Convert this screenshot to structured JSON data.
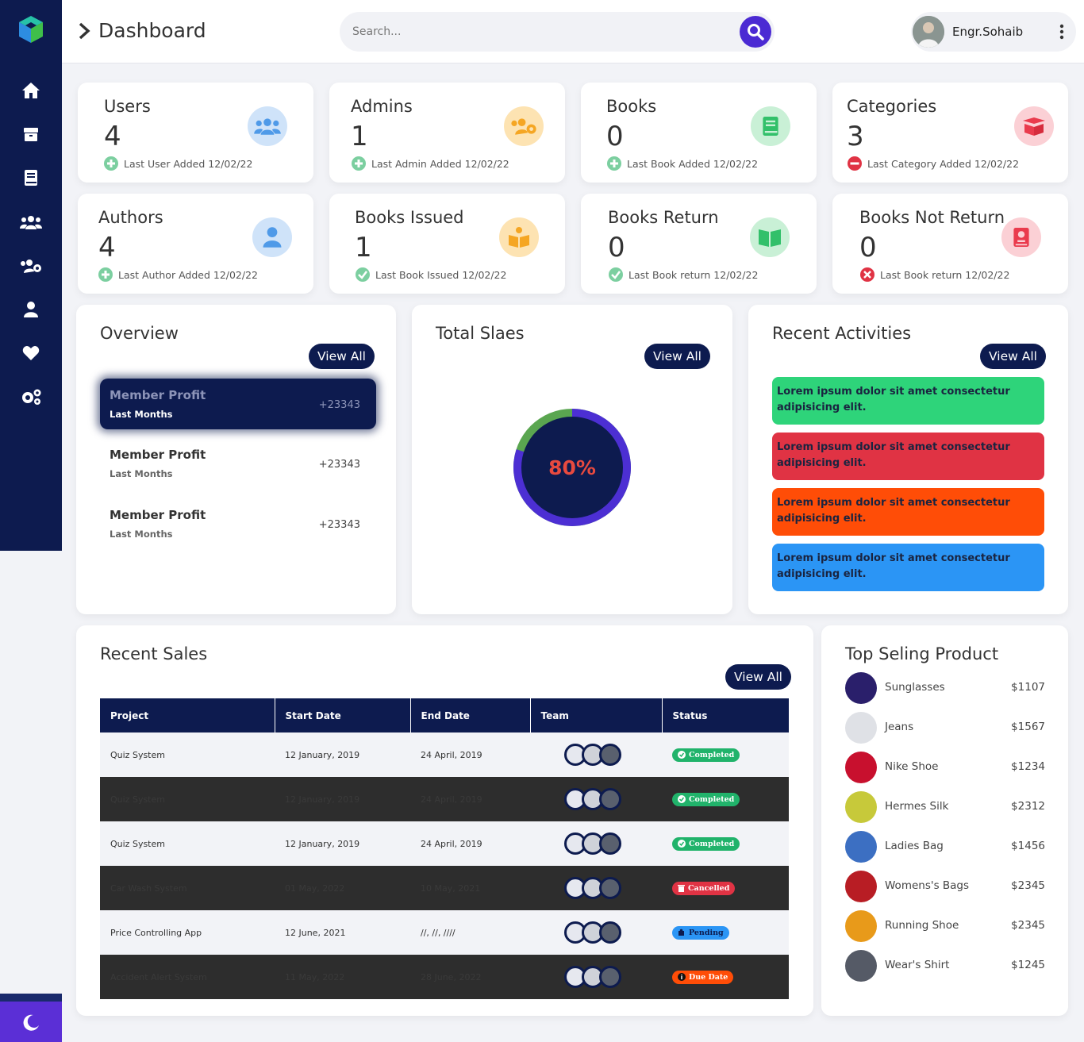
{
  "header": {
    "title": "Dashboard",
    "search_placeholder": "Search...",
    "user_name": "Engr.Sohaib"
  },
  "sidebar": {
    "items": [
      "home-icon",
      "box-icon",
      "book-icon",
      "users-icon",
      "users-cog-icon",
      "user-icon",
      "heart-icon",
      "cogs-icon"
    ],
    "theme_toggle": "moon-icon"
  },
  "stats": [
    {
      "label": "Users",
      "value": "4",
      "footer": "Last User Added 12/02/22",
      "icon": "users-icon",
      "footer_icon": "plus-circle-icon"
    },
    {
      "label": "Admins",
      "value": "1",
      "footer": "Last Admin Added 12/02/22",
      "icon": "users-cog-icon",
      "footer_icon": "plus-circle-icon"
    },
    {
      "label": "Books",
      "value": "0",
      "footer": "Last Book Added 12/02/22",
      "icon": "book-icon",
      "footer_icon": "plus-circle-icon"
    },
    {
      "label": "Categories",
      "value": "3",
      "footer": "Last Category Added 12/02/22",
      "icon": "box-open-icon",
      "footer_icon": "minus-circle-icon"
    },
    {
      "label": "Authors",
      "value": "4",
      "footer": "Last Author Added 12/02/22",
      "icon": "user-icon",
      "footer_icon": "plus-circle-icon"
    },
    {
      "label": "Books Issued",
      "value": "1",
      "footer": "Last Book Issued 12/02/22",
      "icon": "book-reader-icon",
      "footer_icon": "check-circle-icon"
    },
    {
      "label": "Books Return",
      "value": "0",
      "footer": "Last Book return 12/02/22",
      "icon": "book-open-icon",
      "footer_icon": "check-circle-icon"
    },
    {
      "label": "Books Not Return",
      "value": "0",
      "footer": "Last Book return 12/02/22",
      "icon": "book-dead-icon",
      "footer_icon": "times-circle-icon"
    }
  ],
  "overview": {
    "title": "Overview",
    "view_all": "View All",
    "items": [
      {
        "title": "Member Profit",
        "subtitle": "Last Months",
        "value": "+23343"
      },
      {
        "title": "Member Profit",
        "subtitle": "Last Months",
        "value": "+23343"
      },
      {
        "title": "Member Profit",
        "subtitle": "Last Months",
        "value": "+23343"
      }
    ]
  },
  "total_sales": {
    "title": "Total Slaes",
    "view_all": "View All",
    "percent_label": "80%",
    "percent": 80
  },
  "recent_activities": {
    "title": "Recent Activities",
    "view_all": "View All",
    "items": [
      {
        "text": "Lorem ipsum dolor sit amet consectetur adipisicing elit.",
        "color": "#2ed47a"
      },
      {
        "text": "Lorem ipsum dolor sit amet consectetur adipisicing elit.",
        "color": "#e03344"
      },
      {
        "text": "Lorem ipsum dolor sit amet consectetur adipisicing elit.",
        "color": "#ff4d07"
      },
      {
        "text": "Lorem ipsum dolor sit amet consectetur adipisicing elit.",
        "color": "#2b95f5"
      }
    ]
  },
  "recent_sales": {
    "title": "Recent Sales",
    "view_all": "View All",
    "columns": [
      "Project",
      "Start Date",
      "End Date",
      "Team",
      "Status"
    ],
    "rows": [
      {
        "project": "Quiz System",
        "start": "12 January, 2019",
        "end": "24 April, 2019",
        "status": "Completed",
        "status_color": "#21b36b",
        "status_icon": "check-circle-icon",
        "style": "light"
      },
      {
        "project": "Quiz System",
        "start": "12 January, 2019",
        "end": "24 April, 2019",
        "status": "Completed",
        "status_color": "#21b36b",
        "status_icon": "check-circle-icon",
        "style": "dark"
      },
      {
        "project": "Quiz System",
        "start": "12 January, 2019",
        "end": "24 April, 2019",
        "status": "Completed",
        "status_color": "#21b36b",
        "status_icon": "check-circle-icon",
        "style": "light"
      },
      {
        "project": "Car Wash System",
        "start": "01 May, 2022",
        "end": "10 May, 2021",
        "status": "Cancelled",
        "status_color": "#e03344",
        "status_icon": "trash-icon",
        "style": "dark"
      },
      {
        "project": "Price Controlling App",
        "start": "12 June, 2021",
        "end": "//, //, ////",
        "status": "Pending",
        "status_color": "#2b95f5",
        "status_icon": "puzzle-icon",
        "style": "light"
      },
      {
        "project": "Accident Alert System",
        "start": "11 May, 2022",
        "end": "28 June, 2022",
        "status": "Due Date",
        "status_color": "#ff4d07",
        "status_icon": "info-circle-icon",
        "style": "dark"
      }
    ]
  },
  "top_products": {
    "title": "Top Seling Product",
    "items": [
      {
        "name": "Sunglasses",
        "price": "$1107",
        "color": "#2a1f6b"
      },
      {
        "name": "Jeans",
        "price": "$1567",
        "color": "#dfe1e6"
      },
      {
        "name": "Nike Shoe",
        "price": "$1234",
        "color": "#c8102e"
      },
      {
        "name": "Hermes Silk",
        "price": "$2312",
        "color": "#c7c93a"
      },
      {
        "name": "Ladies Bag",
        "price": "$1456",
        "color": "#3c6fc2"
      },
      {
        "name": "Womens's Bags",
        "price": "$2345",
        "color": "#b81d24"
      },
      {
        "name": "Running Shoe",
        "price": "$2345",
        "color": "#e89a1a"
      },
      {
        "name": "Wear's Shirt",
        "price": "$1245",
        "color": "#555a66"
      }
    ]
  }
}
